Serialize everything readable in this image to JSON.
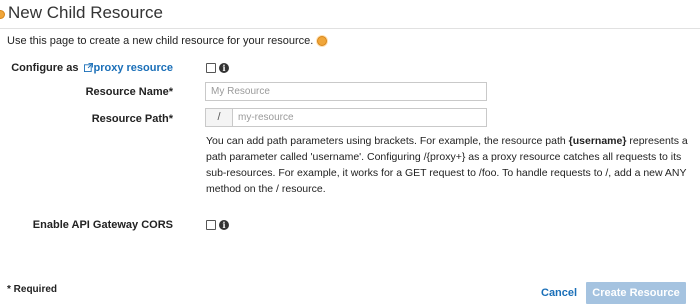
{
  "header": {
    "title": "New Child Resource"
  },
  "intro": {
    "text": "Use this page to create a new child resource for your resource."
  },
  "form": {
    "proxy": {
      "label_prefix": "Configure as",
      "label_link": "proxy resource",
      "checked": false
    },
    "resource_name": {
      "label": "Resource Name*",
      "value": "",
      "placeholder": "My Resource"
    },
    "resource_path": {
      "label": "Resource Path*",
      "prefix": "/",
      "value": "",
      "placeholder": "my-resource"
    },
    "help": {
      "part1": "You can add path parameters using brackets. For example, the resource path ",
      "param": "{username}",
      "part2": " represents a path parameter called 'username'. Configuring /{proxy+} as a proxy resource catches all requests to its sub-resources. For example, it works for a GET request to /foo. To handle requests to /, add a new ANY method on the / resource."
    },
    "cors": {
      "label": "Enable API Gateway CORS",
      "checked": false
    }
  },
  "footer": {
    "required_note": "* Required",
    "cancel_label": "Cancel",
    "create_label": "Create Resource"
  },
  "icons": {
    "info": "info-icon",
    "external_link": "external-link-icon",
    "status_dot": "status-dot-icon"
  },
  "colors": {
    "link": "#1a6fb8",
    "primary_disabled": "#a5c3e0",
    "status_dot": "#f0a63a"
  }
}
